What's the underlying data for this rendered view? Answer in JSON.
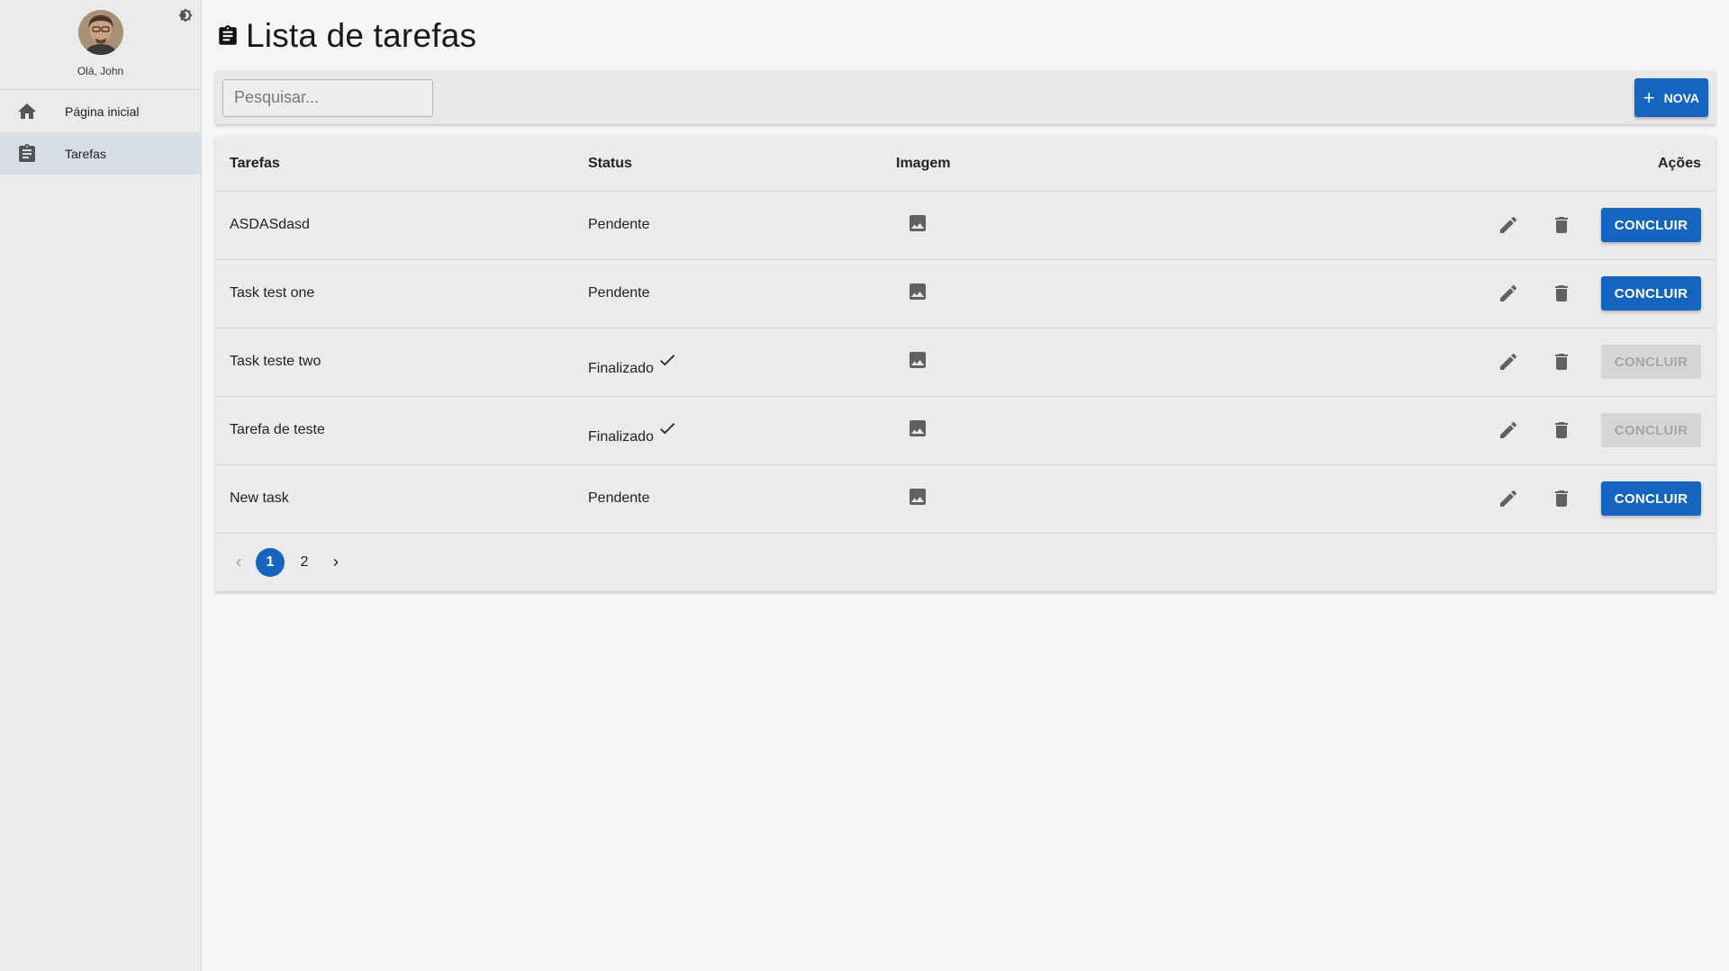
{
  "sidebar": {
    "greeting": "Olá, John",
    "items": [
      {
        "label": "Página inicial",
        "icon": "home-icon"
      },
      {
        "label": "Tarefas",
        "icon": "clipboard-icon"
      }
    ]
  },
  "page": {
    "title": "Lista de tarefas",
    "icon": "clipboard-icon"
  },
  "toolbar": {
    "search_placeholder": "Pesquisar...",
    "new_label": "NOVA"
  },
  "table": {
    "headers": {
      "task": "Tarefas",
      "status": "Status",
      "image": "Imagem",
      "actions": "Ações"
    },
    "rows": [
      {
        "task": "ASDASdasd",
        "status": "Pendente",
        "done": false,
        "action_label": "CONCLUIR"
      },
      {
        "task": "Task test one",
        "status": "Pendente",
        "done": false,
        "action_label": "CONCLUIR"
      },
      {
        "task": "Task teste two",
        "status": "Finalizado",
        "done": true,
        "action_label": "CONCLUIR"
      },
      {
        "task": "Tarefa de teste",
        "status": "Finalizado",
        "done": true,
        "action_label": "CONCLUIR"
      },
      {
        "task": "New task",
        "status": "Pendente",
        "done": false,
        "action_label": "CONCLUIR"
      }
    ]
  },
  "pagination": {
    "pages": [
      "1",
      "2"
    ],
    "current": "1"
  },
  "colors": {
    "primary": "#1565c0",
    "disabled_bg": "#d6d6d6",
    "active_nav": "#d5dde6"
  }
}
